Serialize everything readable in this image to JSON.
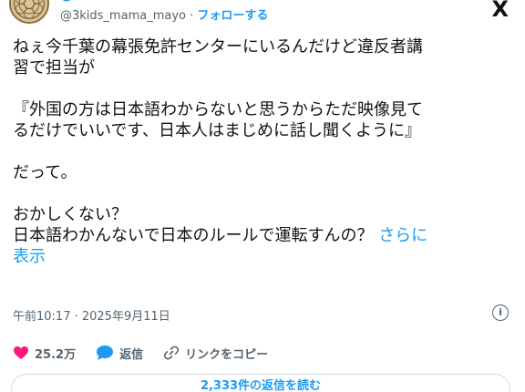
{
  "header": {
    "handle": "@3kids_mama_mayo",
    "separator": " · ",
    "follow_label": "フォローする",
    "close_glyph": "X"
  },
  "tweet": {
    "lines": [
      "ねぇ今千葉の幕張免許センターにいるんだけど違反者講\n習で担当が",
      "『外国の方は日本語わからないと思うからただ映像見て\nるだけでいいです、日本人はまじめに話し聞くように』",
      "だって。",
      "おかしくない？\n日本語わかんないで日本のルールで運転すんの？ "
    ],
    "show_more_label": "さらに\n表示"
  },
  "meta": {
    "timestamp": "午前10:17 · 2025年9月11日",
    "info_glyph": "i"
  },
  "actions": {
    "like_count": "25.2万",
    "reply_label": "返信",
    "copy_link_label": "リンクをコピー"
  },
  "replies_button": {
    "label": "2,333件の返信を読む"
  },
  "colors": {
    "accent": "#1d9bf0",
    "like": "#f91880",
    "muted": "#536471"
  }
}
